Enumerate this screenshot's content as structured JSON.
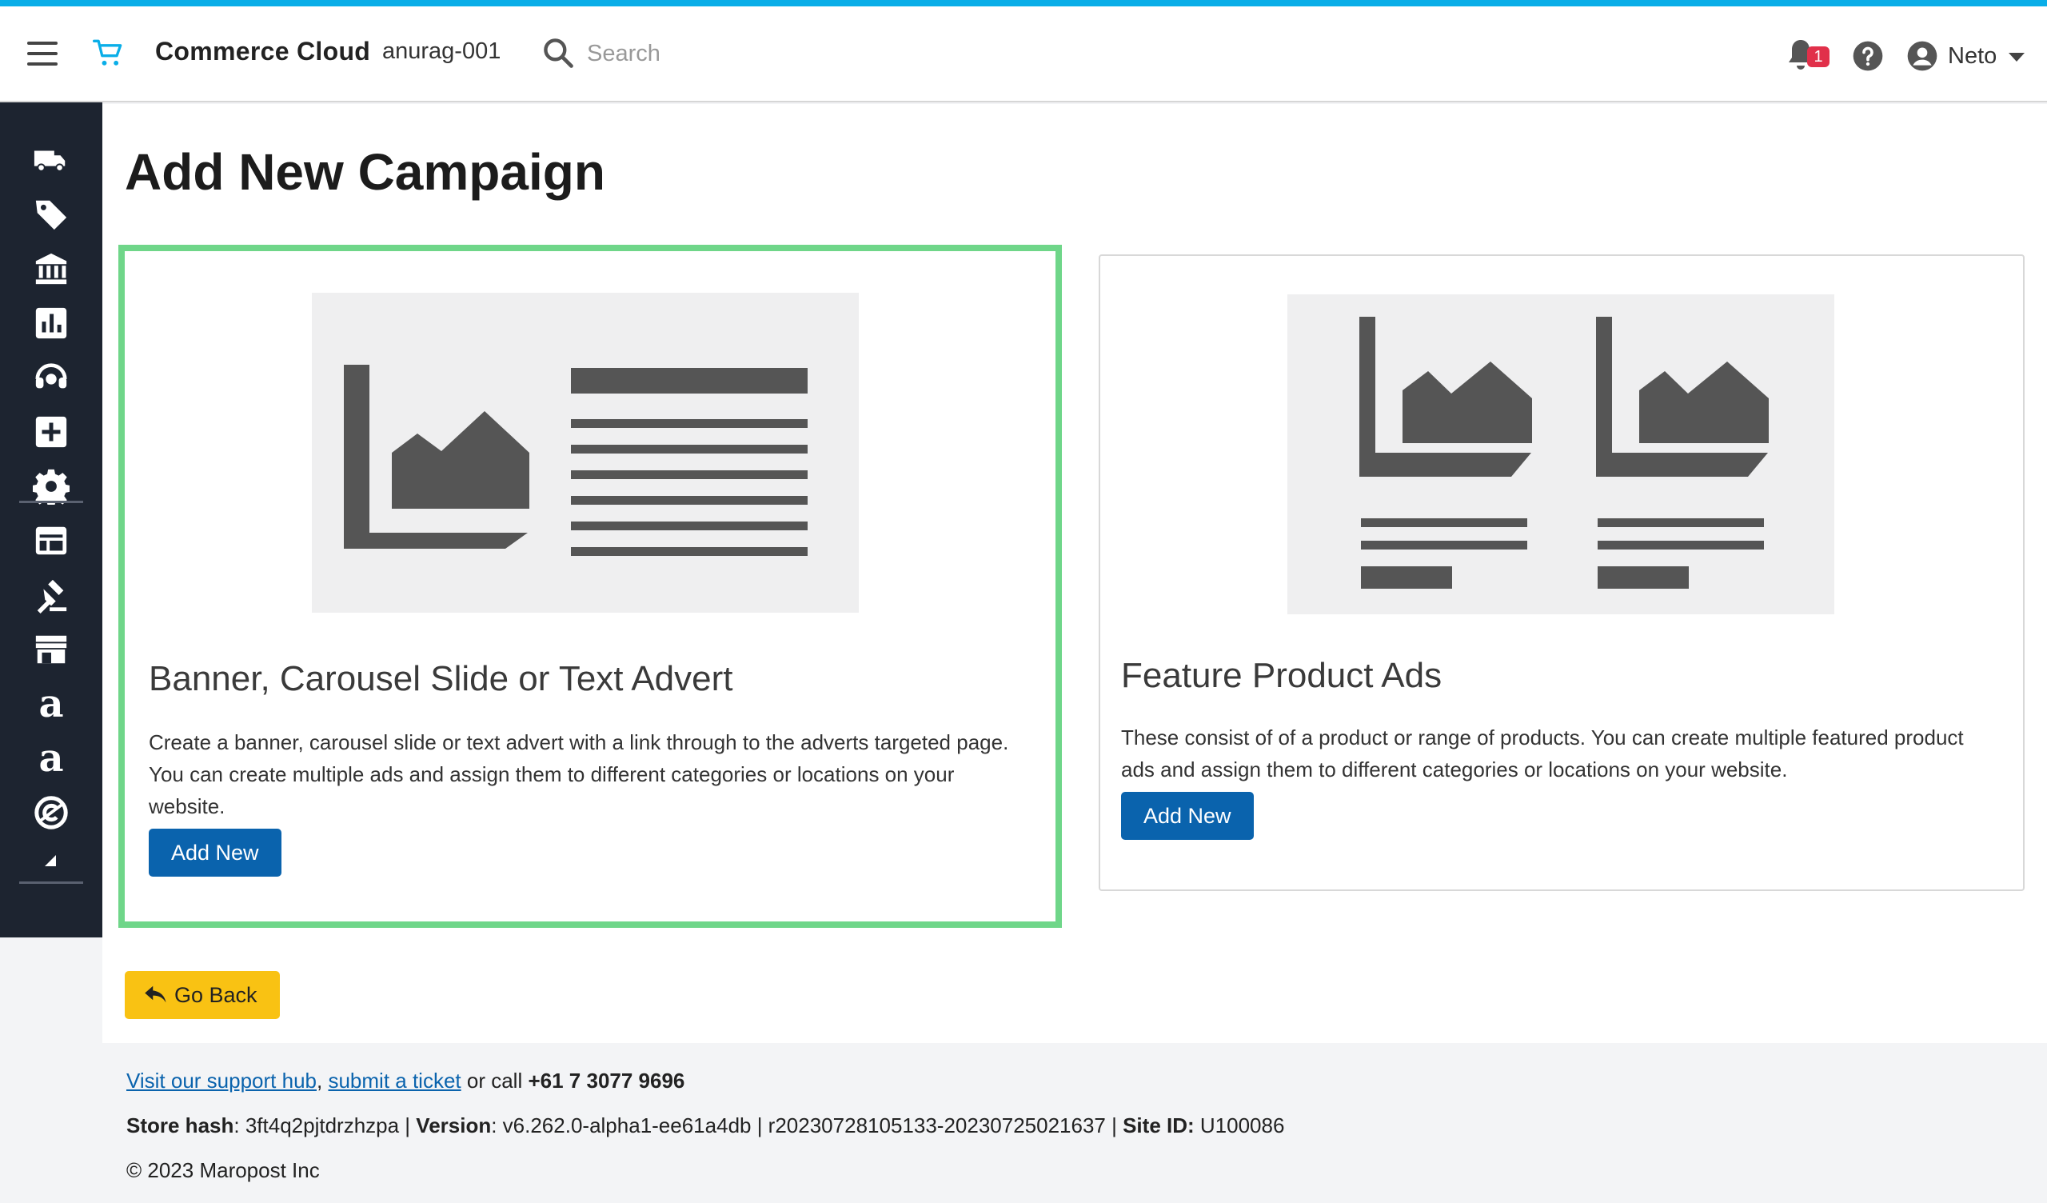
{
  "header": {
    "brand": "Commerce Cloud",
    "store_name": "anurag-001",
    "search_placeholder": "Search",
    "notification_count": "1",
    "user_name": "Neto",
    "accent_color": "#0aaee8"
  },
  "sidebar": {
    "icons": [
      "truck-icon",
      "tag-icon",
      "bank-icon",
      "chart-icon",
      "headset-icon",
      "plus-square-icon",
      "gear-icon",
      "layout-icon",
      "gavel-icon",
      "storefront-icon",
      "amazon-icon",
      "amazon-icon",
      "c-logo-icon",
      "collapse-icon"
    ],
    "amazon_glyph": "a"
  },
  "main": {
    "title": "Add New Campaign",
    "cards": [
      {
        "title": "Banner, Carousel Slide or Text Advert",
        "description": "Create a banner, carousel slide or text advert with a link through to the adverts targeted page. You can create multiple ads and assign them to different categories or locations on your website.",
        "button_label": "Add New",
        "selected": true
      },
      {
        "title": "Feature Product Ads",
        "description": "These consist of of a product or range of products. You can create multiple featured product ads and assign them to different categories or locations on your website.",
        "button_label": "Add New",
        "selected": false
      }
    ],
    "go_back_label": "Go Back",
    "primary_color": "#0a63ad",
    "selected_border_color": "#6fd689",
    "go_back_color": "#f9c213"
  },
  "footer": {
    "support_link": "Visit our support hub",
    "comma": ",",
    "ticket_link": "submit a ticket",
    "call_text": "or call",
    "phone": "+61 7 3077 9696",
    "store_hash_label": "Store hash",
    "store_hash": ": 3ft4q2pjtdrzhzpa | ",
    "version_label": "Version",
    "version": ": v6.262.0-alpha1-ee61a4db | r20230728105133-20230725021637 | ",
    "site_id_label": "Site ID:",
    "site_id": " U100086",
    "copyright": "© 2023 Maropost Inc"
  }
}
